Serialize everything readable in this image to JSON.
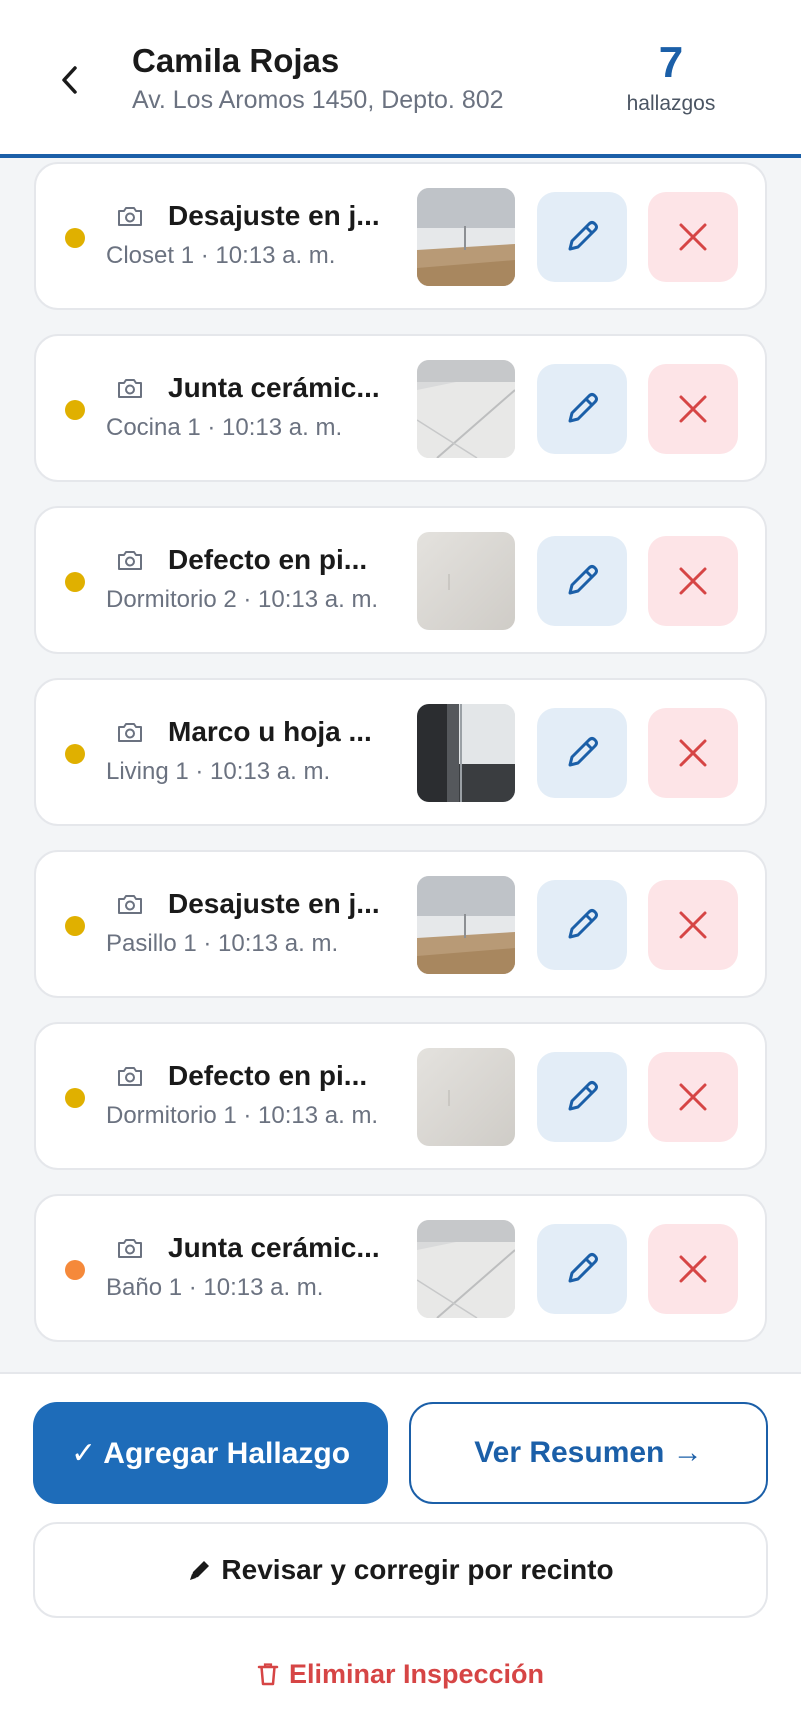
{
  "header": {
    "back_icon": "chevron-left-icon",
    "name": "Camila Rojas",
    "address": "Av. Los Aromos 1450, Depto. 802",
    "count": "7",
    "count_label": "hallazgos"
  },
  "colors": {
    "primary": "#1b5fa8",
    "severity_yellow": "#e0b000",
    "severity_orange": "#f5893a",
    "edit_bg": "#e3edf7",
    "delete_bg": "#fde4e7",
    "danger": "#d64545"
  },
  "findings": [
    {
      "title": "Desajuste en j...",
      "subtitle": "Closet 1 · 10:13 a. m.",
      "severity": "yellow",
      "photo": "baseboard-floor"
    },
    {
      "title": "Junta cerámic...",
      "subtitle": "Cocina 1 · 10:13 a. m.",
      "severity": "yellow",
      "photo": "ceramic-tile"
    },
    {
      "title": "Defecto en pi...",
      "subtitle": "Dormitorio 2 · 10:13 a. m.",
      "severity": "yellow",
      "photo": "painted-wall"
    },
    {
      "title": "Marco u hoja ...",
      "subtitle": "Living 1 · 10:13 a. m.",
      "severity": "yellow",
      "photo": "window-frame"
    },
    {
      "title": "Desajuste en j...",
      "subtitle": "Pasillo 1 · 10:13 a. m.",
      "severity": "yellow",
      "photo": "baseboard-floor"
    },
    {
      "title": "Defecto en pi...",
      "subtitle": "Dormitorio 1 · 10:13 a. m.",
      "severity": "yellow",
      "photo": "painted-wall"
    },
    {
      "title": "Junta cerámic...",
      "subtitle": "Baño 1 · 10:13 a. m.",
      "severity": "orange",
      "photo": "ceramic-tile"
    }
  ],
  "footer": {
    "add_label": "✓ Agregar Hallazgo",
    "summary_label": "Ver Resumen →",
    "review_icon": "pencil-icon",
    "review_label": "Revisar y corregir por recinto",
    "delete_icon": "trash-icon",
    "delete_label": "Eliminar Inspección"
  }
}
